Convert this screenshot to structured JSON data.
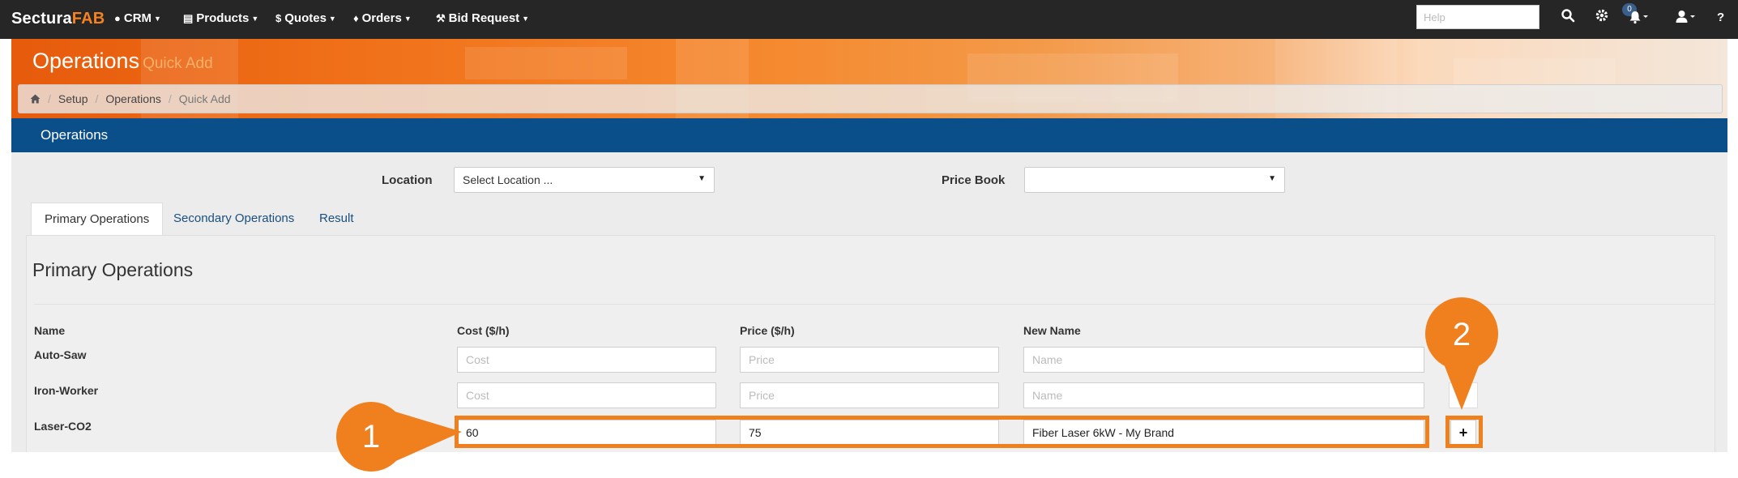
{
  "brand": {
    "part1": "Sectura",
    "part2": "FAB"
  },
  "nav": {
    "items": [
      {
        "label": "CRM",
        "icon": "user-icon"
      },
      {
        "label": "Products",
        "icon": "list-icon"
      },
      {
        "label": "Quotes",
        "icon": "dollar-icon"
      },
      {
        "label": "Orders",
        "icon": "bell-icon"
      },
      {
        "label": "Bid Request",
        "icon": "gavel-icon"
      }
    ],
    "help_placeholder": "Help",
    "notifications_count": "0",
    "help_label": "?"
  },
  "header": {
    "title": "Operations",
    "subtitle": "Quick Add",
    "breadcrumbs": [
      "Setup",
      "Operations",
      "Quick Add"
    ]
  },
  "section_bar": {
    "label": "Operations"
  },
  "filters": {
    "location_label": "Location",
    "location_value": "Select Location ...",
    "pricebook_label": "Price Book",
    "pricebook_value": ""
  },
  "tabs": [
    {
      "label": "Primary Operations",
      "active": true
    },
    {
      "label": "Secondary Operations",
      "active": false
    },
    {
      "label": "Result",
      "active": false
    }
  ],
  "primary": {
    "title": "Primary Operations",
    "columns": [
      "Name",
      "Cost ($/h)",
      "Price ($/h)",
      "New Name"
    ],
    "placeholders": {
      "cost": "Cost",
      "price": "Price",
      "name": "Name"
    },
    "rows": [
      {
        "name": "Auto-Saw",
        "cost": "",
        "price": "",
        "new_name": ""
      },
      {
        "name": "Iron-Worker",
        "cost": "",
        "price": "",
        "new_name": ""
      },
      {
        "name": "Laser-CO2",
        "cost": "60",
        "price": "75",
        "new_name": "Fiber Laser 6kW - My Brand"
      }
    ],
    "add_label": "+"
  },
  "callouts": {
    "one": "1",
    "two": "2"
  },
  "colors": {
    "accent": "#f07f1e",
    "nav_bg": "#262626",
    "bar_blue": "#0b4f8a"
  }
}
